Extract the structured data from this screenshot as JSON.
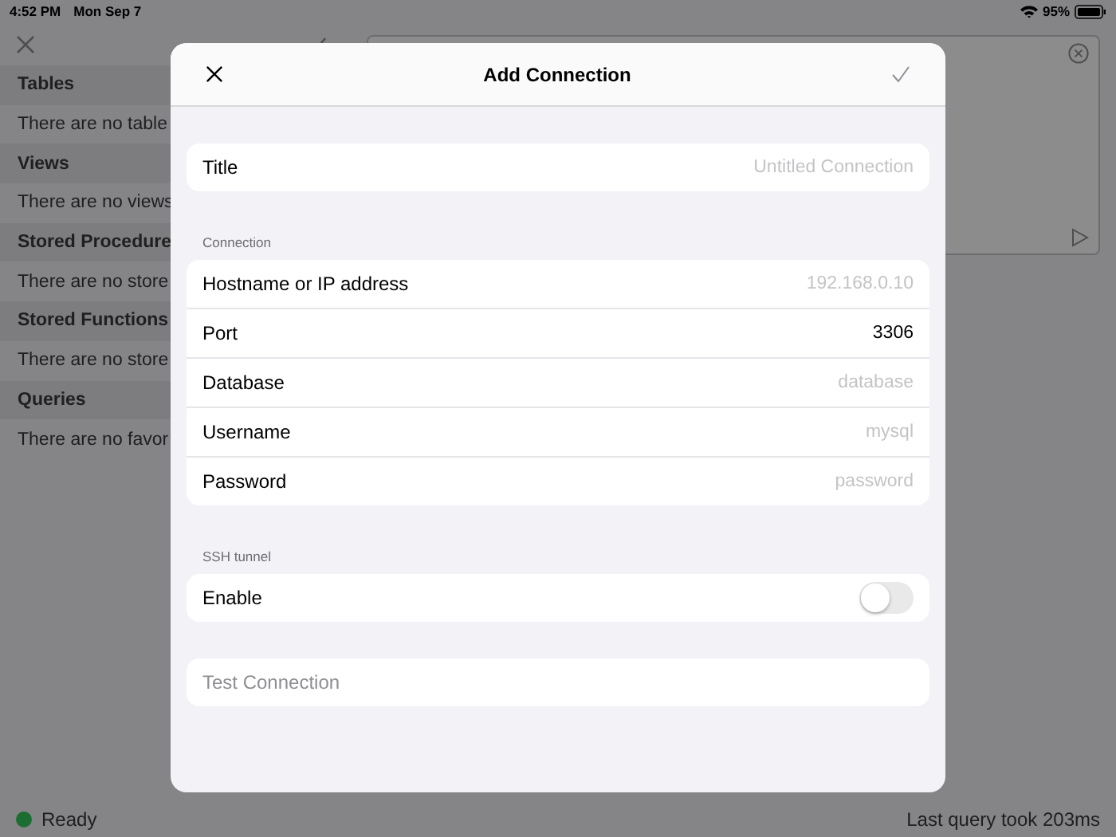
{
  "status_bar": {
    "time": "4:52 PM",
    "date": "Mon Sep 7",
    "battery": "95%"
  },
  "sidebar": {
    "sections": [
      {
        "title": "Tables",
        "empty_text": "There are no table"
      },
      {
        "title": "Views",
        "empty_text": "There are no views"
      },
      {
        "title": "Stored Procedure",
        "empty_text": "There are no store"
      },
      {
        "title": "Stored Functions",
        "empty_text": "There are no store"
      },
      {
        "title": "Queries",
        "empty_text": "There are no favor"
      }
    ]
  },
  "footer": {
    "status": "Ready",
    "query_time": "Last query took 203ms"
  },
  "dialog": {
    "title": "Add Connection",
    "groups": [
      {
        "rows": [
          {
            "kind": "field",
            "label": "Title",
            "placeholder": "Untitled Connection"
          }
        ]
      },
      {
        "header": "Connection",
        "rows": [
          {
            "kind": "field",
            "label": "Hostname or IP address",
            "placeholder": "192.168.0.10"
          },
          {
            "kind": "field",
            "label": "Port",
            "value": "3306"
          },
          {
            "kind": "field",
            "label": "Database",
            "placeholder": "database"
          },
          {
            "kind": "field",
            "label": "Username",
            "placeholder": "mysql"
          },
          {
            "kind": "field",
            "label": "Password",
            "placeholder": "password"
          }
        ]
      },
      {
        "header": "SSH tunnel",
        "rows": [
          {
            "kind": "toggle",
            "label": "Enable",
            "on": false
          }
        ]
      },
      {
        "rows": [
          {
            "kind": "button",
            "label": "Test Connection",
            "disabled": true
          }
        ]
      }
    ]
  }
}
